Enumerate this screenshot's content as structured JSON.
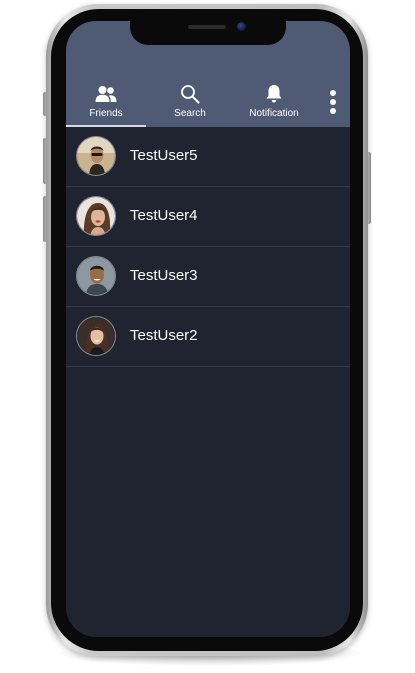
{
  "tabs": {
    "friends": {
      "label": "Friends",
      "icon": "people-icon"
    },
    "search": {
      "label": "Search",
      "icon": "search-icon"
    },
    "notification": {
      "label": "Notification",
      "icon": "bell-icon"
    },
    "more_icon": "more-vertical-icon",
    "active": "friends"
  },
  "friends": [
    {
      "name": "TestUser5",
      "avatar": "avatar-photo"
    },
    {
      "name": "TestUser4",
      "avatar": "avatar-photo"
    },
    {
      "name": "TestUser3",
      "avatar": "avatar-photo"
    },
    {
      "name": "TestUser2",
      "avatar": "avatar-photo"
    }
  ],
  "colors": {
    "appbar": "#4f5b74",
    "background": "#1f2430",
    "divider": "#343a48",
    "text": "#ffffff"
  }
}
